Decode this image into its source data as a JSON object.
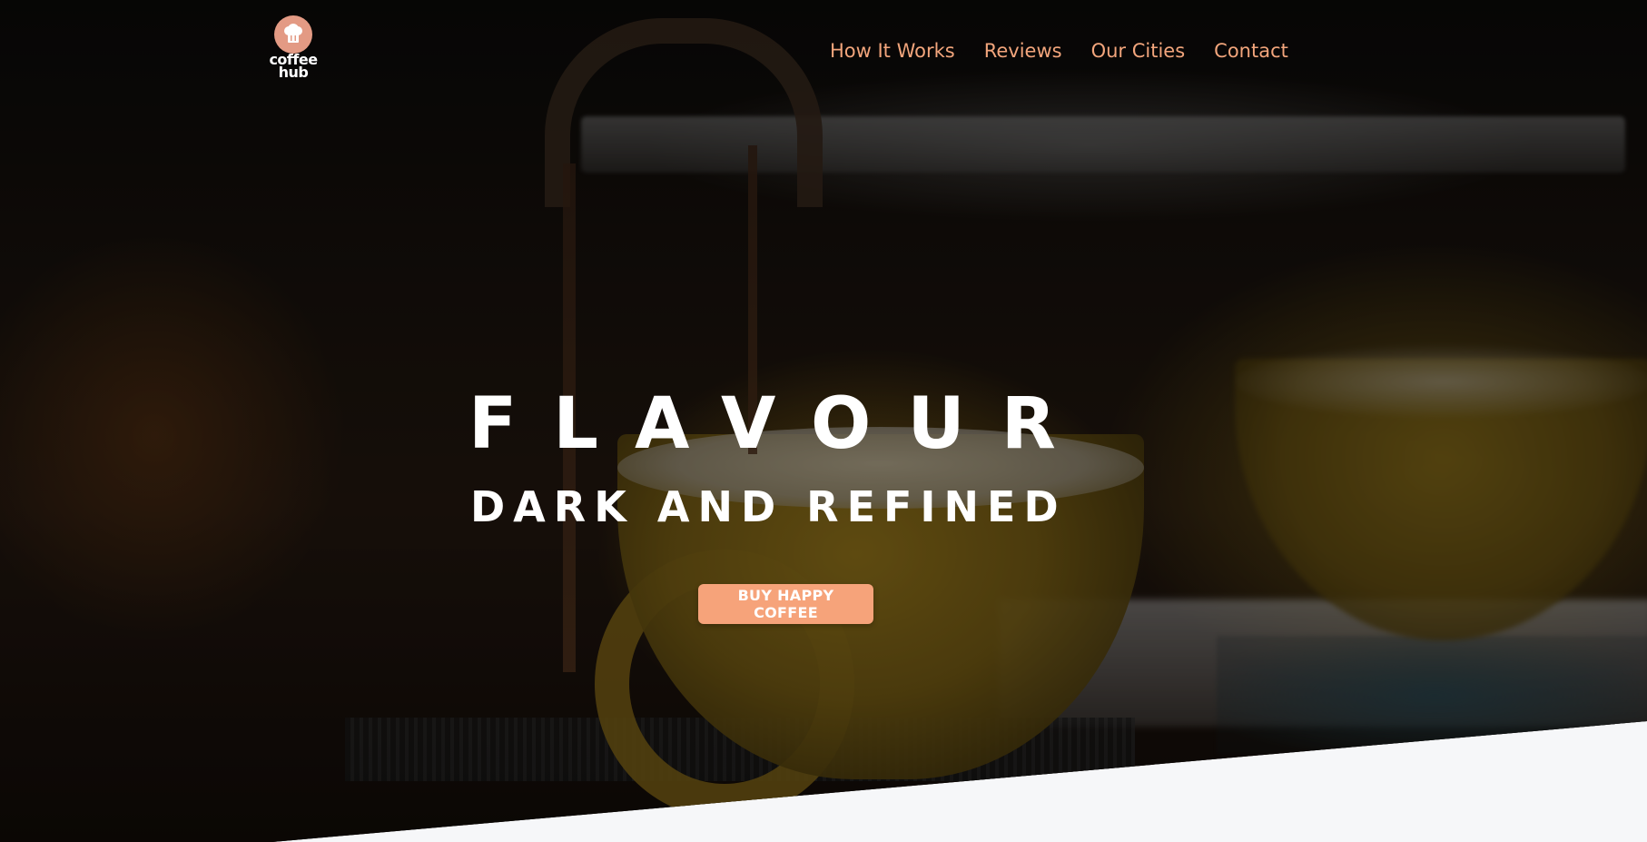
{
  "brand": {
    "logo_line1": "coffee",
    "logo_line2": "hub",
    "logo_color": "#e39a84"
  },
  "nav": {
    "items": [
      {
        "label": "How It Works"
      },
      {
        "label": "Reviews"
      },
      {
        "label": "Our Cities"
      },
      {
        "label": "Contact"
      }
    ],
    "link_color": "#f2a57c"
  },
  "hero": {
    "title": "FLAVOUR",
    "subtitle": "DARK AND REFINED",
    "cta_label": "BUY HAPPY COFFEE",
    "cta_color": "#f6a37a",
    "background_image": "espresso-machine-pouring-into-yellow-cup"
  },
  "colors": {
    "section_bg": "#f6f7f9",
    "text_light": "#ffffff"
  }
}
